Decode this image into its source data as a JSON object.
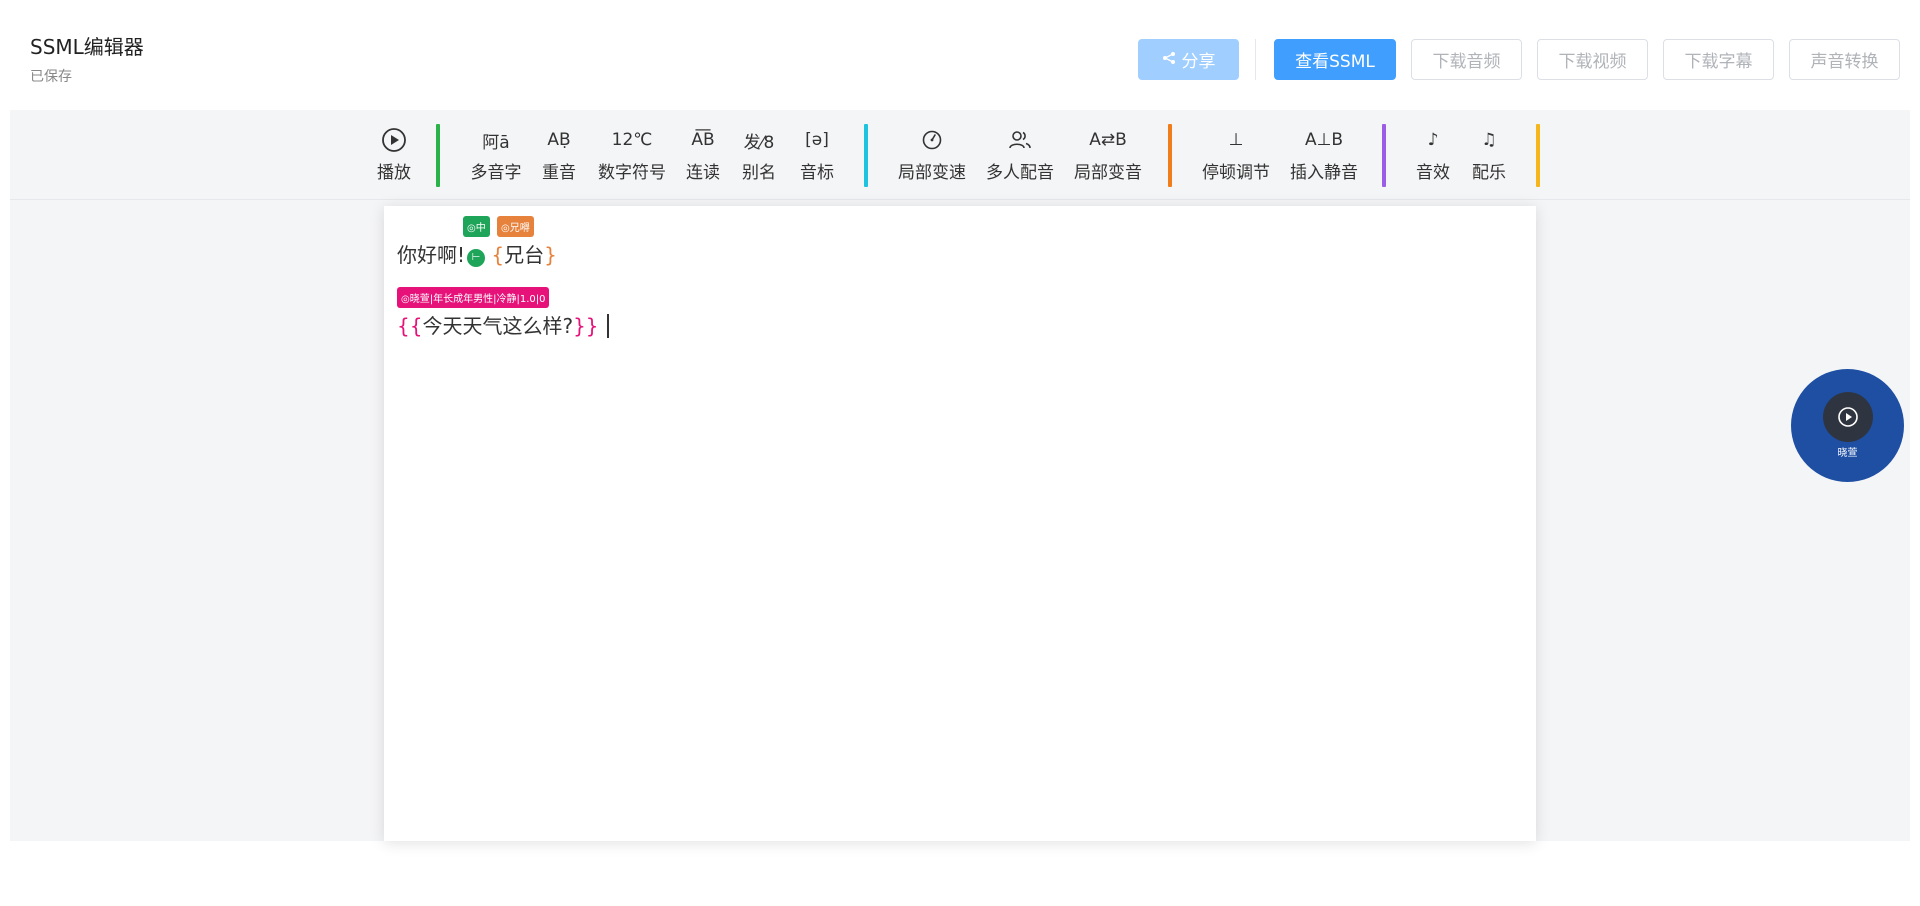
{
  "header": {
    "title": "SSML编辑器",
    "status": "已保存",
    "buttons": {
      "share": "分享",
      "view_ssml": "查看SSML",
      "download_audio": "下载音频",
      "download_video": "下载视频",
      "download_subtitle": "下载字幕",
      "voice_convert": "声音转换"
    }
  },
  "toolbar": {
    "play": {
      "label": "播放",
      "icon": "play-circle-icon"
    },
    "polyphone": {
      "label": "多音字",
      "icon_text": "阿ā"
    },
    "stress": {
      "label": "重音",
      "icon_text": "AḄ"
    },
    "number_symbol": {
      "label": "数字符号",
      "icon_text": "12℃"
    },
    "liaison": {
      "label": "连读",
      "icon_text": "A͞B"
    },
    "alias": {
      "label": "别名",
      "icon_text": "发⁄8"
    },
    "phonetic": {
      "label": "音标",
      "icon_text": "[ə]"
    },
    "local_speed": {
      "label": "局部变速",
      "icon": "gauge-icon"
    },
    "multi_voice": {
      "label": "多人配音",
      "icon": "users-icon"
    },
    "local_voice_change": {
      "label": "局部变音",
      "icon_text": "A⇄B"
    },
    "pause_adjust": {
      "label": "停顿调节",
      "icon_text": "⊥"
    },
    "insert_silence": {
      "label": "插入静音",
      "icon_text": "A⊥B"
    },
    "sound_effect": {
      "label": "音效",
      "icon_text": "♪"
    },
    "music": {
      "label": "配乐",
      "icon_text": "♫"
    },
    "separator_colors": [
      "#2bb34a",
      "#1ec3e0",
      "#f07d1a",
      "#9b5de5",
      "#f5b51d"
    ]
  },
  "editor": {
    "line1": {
      "text": "你好啊!",
      "pause_mark": "⊢",
      "alias_text": "兄台",
      "brace_open": "{",
      "brace_close": "}",
      "tag_pause": "◎中",
      "tag_alias": "◎兄嘚"
    },
    "line2": {
      "text": "今天天气这么样?",
      "brace_open": "{{",
      "brace_close": "}}",
      "tag_voice": "◎晓萱|年长成年男性|冷静|1.0|0"
    }
  },
  "voice_fab": {
    "name": "晓萱",
    "icon": "play-icon"
  },
  "colors": {
    "primary": "#409eff",
    "primary_light": "#a0cfff",
    "green_tag": "#1fa55a",
    "orange_tag": "#e6823c",
    "pink_tag": "#e6127a",
    "fab_bg": "#1e4fa3"
  }
}
